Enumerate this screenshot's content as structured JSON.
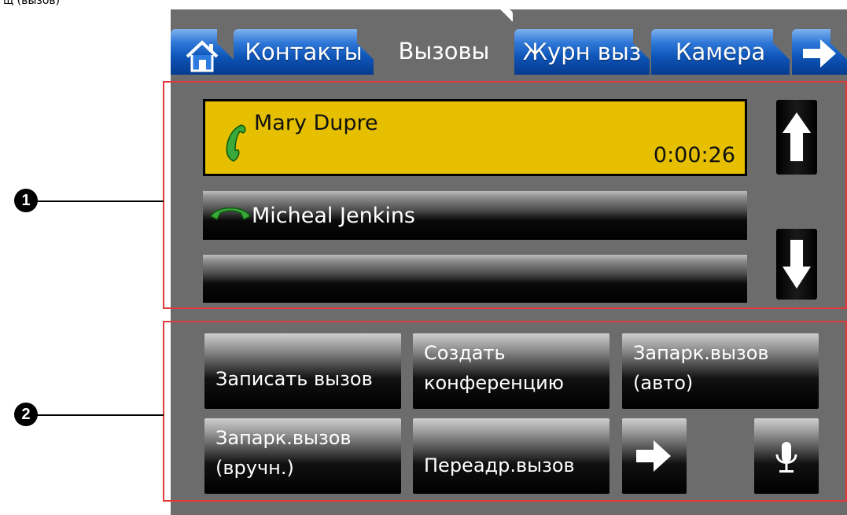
{
  "header_caption": "щ (вызов)",
  "tabs": [
    {
      "label": "",
      "icon": "home-icon"
    },
    {
      "label": "Контакты"
    },
    {
      "label": "Вызовы"
    },
    {
      "label": "Журн выз"
    },
    {
      "label": "Камера"
    },
    {
      "label": "",
      "icon": "arrow-right-icon"
    }
  ],
  "calls": {
    "active": {
      "name": "Mary Dupre",
      "timer": "0:00:26",
      "state": "active",
      "color": "#e5bf00"
    },
    "held": {
      "name": "Micheal Jenkins",
      "state": "held"
    },
    "empty": {
      "name": ""
    }
  },
  "actions": {
    "record": "Записать вызов",
    "conference": [
      "Создать",
      "конференцию"
    ],
    "park_auto": [
      "Запарк.вызов",
      "(авто)"
    ],
    "park_manual": [
      "Запарк.вызов",
      "(вручн.)"
    ],
    "forward": "Переадр.вызов"
  },
  "callouts": [
    "1",
    "2"
  ],
  "colors": {
    "tab_blue": "#0e55b8",
    "highlight": "#e5bf00",
    "frame_red": "#e03a3a",
    "screen_bg": "#6c6c6c"
  }
}
